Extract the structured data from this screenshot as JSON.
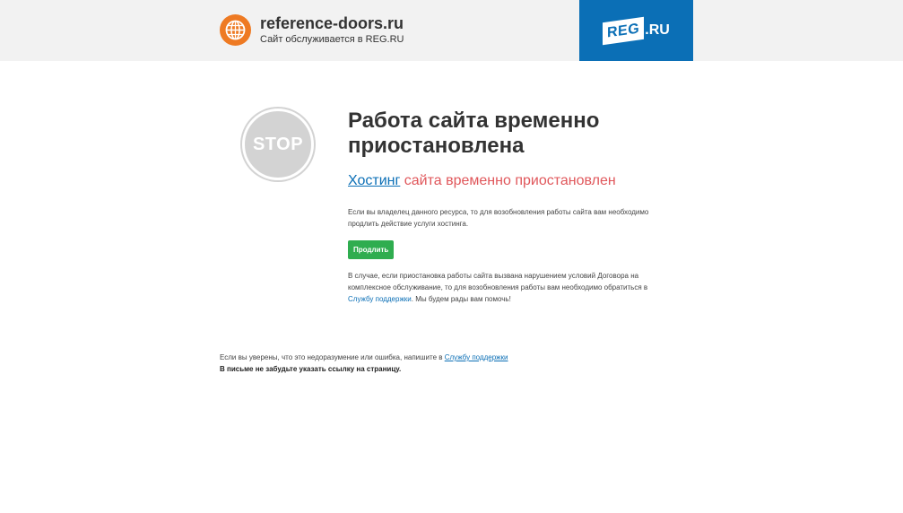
{
  "header": {
    "site_domain": "reference-doors.ru",
    "site_subtitle": "Сайт обслуживается в REG.RU",
    "globe_icon": "globe-icon",
    "reg_logo_box": "REG",
    "reg_logo_suffix": ".RU"
  },
  "stop": {
    "label": "STOP"
  },
  "main": {
    "title": "Работа сайта временно приостановлена",
    "subtitle_link": "Хостинг",
    "subtitle_rest": " сайта временно приостановлен",
    "para1": "Если вы владелец данного ресурса, то для возобновления работы сайта вам необходимо продлить действие услуги хостинга.",
    "renew_button": "Продлить",
    "para2_before": "В случае, если приостановка работы сайта вызвана нарушением условий Договора на комплексное обслуживание, то для возобновления работы вам необходимо обратиться в ",
    "para2_link": "Службу поддержки",
    "para2_after": ". Мы будем рады вам помочь!"
  },
  "footer": {
    "line1_before": "Если вы уверены, что это недоразумение или ошибка, напишите в ",
    "line1_link": "Службу поддержки",
    "line2": "В письме не забудьте указать ссылку на страницу."
  },
  "colors": {
    "accent_blue": "#0b6fb6",
    "alert_red": "#e0575b",
    "button_green": "#2fad4f",
    "globe_orange": "#ee7a23",
    "stop_gray": "#d3d3d3"
  }
}
